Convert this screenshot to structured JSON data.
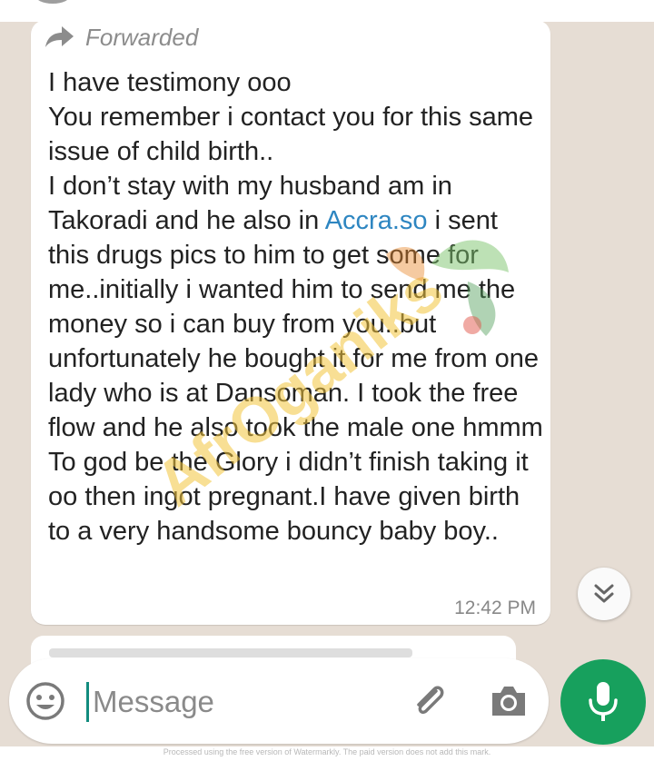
{
  "message": {
    "forwarded_label": "Forwarded",
    "lines_before_link": "I have testimony ooo\nYou remember i contact you for this same issue of child birth..\nI don’t stay with my husband am in Takoradi and he also in ",
    "link_text": "Accra.so",
    "lines_after_link": " i sent this drugs pics to him to get some for me..initially i wanted him to send me the money so i can buy from you..but unfortunately he bought it for me from one lady who is at Dansoman. I took the free flow and he also took the male one hmmm To god be the Glory i didn’t finish taking it oo then ingot pregnant.I have given birth to a very handsome bouncy baby boy..",
    "timestamp": "12:42 PM"
  },
  "composer": {
    "placeholder": "Message"
  },
  "watermark": {
    "brand": "AfrOganiks",
    "footer": "Processed using the free version of Watermarkly. The paid version does not add this mark."
  },
  "colors": {
    "background": "#e6ddd4",
    "bubble": "#ffffff",
    "link": "#2e86c1",
    "mic_button": "#17a05d",
    "watermark_brand": "#f2c53d"
  },
  "icons": {
    "forward": "forward-arrow-icon",
    "scroll_down": "double-chevron-down-icon",
    "emoji": "emoji-icon",
    "attach": "paperclip-icon",
    "camera": "camera-icon",
    "mic": "microphone-icon"
  }
}
